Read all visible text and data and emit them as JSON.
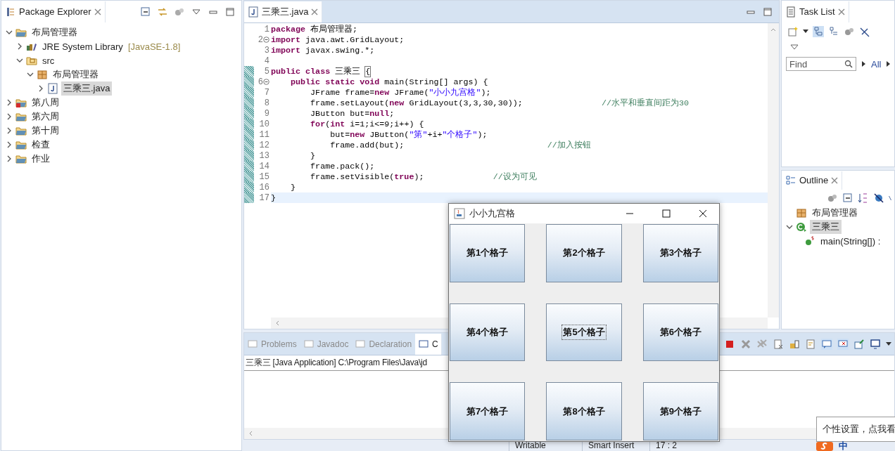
{
  "package_explorer": {
    "title": "Package Explorer",
    "tree": [
      {
        "label": "布局管理器",
        "kind": "project",
        "expanded": true,
        "selected": false,
        "children": [
          {
            "label": "JRE System Library",
            "decoration": "[JavaSE-1.8]",
            "kind": "library",
            "expanded": false,
            "selected": false
          },
          {
            "label": "src",
            "kind": "source",
            "expanded": true,
            "selected": false,
            "children": [
              {
                "label": "布局管理器",
                "kind": "package",
                "expanded": true,
                "selected": false,
                "children": [
                  {
                    "label": "三乘三.java",
                    "kind": "java",
                    "expanded": false,
                    "selected": true
                  }
                ]
              }
            ]
          }
        ]
      },
      {
        "label": "第八周",
        "kind": "project_error",
        "expanded": false,
        "selected": false
      },
      {
        "label": "第六周",
        "kind": "project",
        "expanded": false,
        "selected": false
      },
      {
        "label": "第十周",
        "kind": "project",
        "expanded": false,
        "selected": false
      },
      {
        "label": "检查",
        "kind": "project",
        "expanded": false,
        "selected": false
      },
      {
        "label": "作业",
        "kind": "project",
        "expanded": false,
        "selected": false
      }
    ]
  },
  "editor": {
    "tab": {
      "label": "三乘三.java",
      "selected": true
    },
    "lines": [
      {
        "n": "1",
        "changed": false,
        "foldable": false,
        "current": false,
        "tokens": [
          {
            "kind": "keyword",
            "text": "package"
          },
          {
            "kind": "plain",
            "text": " 布局管理器;"
          }
        ]
      },
      {
        "n": "2",
        "changed": false,
        "foldable": true,
        "current": false,
        "tokens": [
          {
            "kind": "keyword",
            "text": "import"
          },
          {
            "kind": "plain",
            "text": " java.awt.GridLayout;"
          }
        ]
      },
      {
        "n": "3",
        "changed": false,
        "foldable": false,
        "current": false,
        "tokens": [
          {
            "kind": "keyword",
            "text": "import"
          },
          {
            "kind": "plain",
            "text": " javax.swing.*;"
          }
        ]
      },
      {
        "n": "4",
        "changed": false,
        "foldable": false,
        "current": false
      },
      {
        "n": "5",
        "changed": true,
        "foldable": false,
        "current": false,
        "tokens": [
          {
            "kind": "keyword",
            "text": "public class"
          },
          {
            "kind": "plain",
            "text": " 三乘三 "
          },
          {
            "kind": "bracket",
            "text": "{"
          }
        ]
      },
      {
        "n": "6",
        "changed": true,
        "foldable": true,
        "current": false,
        "tokens": [
          {
            "kind": "keyword",
            "text": "    public static void"
          },
          {
            "kind": "plain",
            "text": " main(String[] args) {"
          }
        ]
      },
      {
        "n": "7",
        "changed": true,
        "foldable": false,
        "current": false,
        "tokens": [
          {
            "kind": "plain",
            "text": "        JFrame frame="
          },
          {
            "kind": "keyword",
            "text": "new"
          },
          {
            "kind": "plain",
            "text": " JFrame("
          },
          {
            "kind": "string",
            "text": "\"小小九宫格\""
          },
          {
            "kind": "plain",
            "text": ");"
          }
        ]
      },
      {
        "n": "8",
        "changed": true,
        "foldable": false,
        "current": false,
        "tokens": [
          {
            "kind": "plain",
            "text": "        frame.setLayout("
          },
          {
            "kind": "keyword",
            "text": "new"
          },
          {
            "kind": "plain",
            "text": " GridLayout(3,3,30,30));                "
          },
          {
            "kind": "comment",
            "text": "//水平和垂直间距为30"
          }
        ]
      },
      {
        "n": "9",
        "changed": true,
        "foldable": false,
        "current": false,
        "tokens": [
          {
            "kind": "plain",
            "text": "        JButton but="
          },
          {
            "kind": "keyword",
            "text": "null"
          },
          {
            "kind": "plain",
            "text": ";"
          }
        ]
      },
      {
        "n": "10",
        "changed": true,
        "foldable": false,
        "current": false,
        "tokens": [
          {
            "kind": "keyword",
            "text": "        for"
          },
          {
            "kind": "plain",
            "text": "("
          },
          {
            "kind": "keyword",
            "text": "int"
          },
          {
            "kind": "plain",
            "text": " i=1;i<=9;i++) {"
          }
        ]
      },
      {
        "n": "11",
        "changed": true,
        "foldable": false,
        "current": false,
        "tokens": [
          {
            "kind": "plain",
            "text": "            but="
          },
          {
            "kind": "keyword",
            "text": "new"
          },
          {
            "kind": "plain",
            "text": " JButton("
          },
          {
            "kind": "string",
            "text": "\"第\""
          },
          {
            "kind": "plain",
            "text": "+i+"
          },
          {
            "kind": "string",
            "text": "\"个格子\""
          },
          {
            "kind": "plain",
            "text": ");"
          }
        ]
      },
      {
        "n": "12",
        "changed": true,
        "foldable": false,
        "current": false,
        "tokens": [
          {
            "kind": "plain",
            "text": "            frame.add(but);                             "
          },
          {
            "kind": "comment",
            "text": "//加入按钮"
          }
        ]
      },
      {
        "n": "13",
        "changed": true,
        "foldable": false,
        "current": false,
        "tokens": [
          {
            "kind": "plain",
            "text": "        }"
          }
        ]
      },
      {
        "n": "14",
        "changed": true,
        "foldable": false,
        "current": false,
        "tokens": [
          {
            "kind": "plain",
            "text": "        frame.pack();"
          }
        ]
      },
      {
        "n": "15",
        "changed": true,
        "foldable": false,
        "current": false,
        "tokens": [
          {
            "kind": "plain",
            "text": "        frame.setVisible("
          },
          {
            "kind": "keyword",
            "text": "true"
          },
          {
            "kind": "plain",
            "text": ");              "
          },
          {
            "kind": "comment",
            "text": "//设为可见"
          }
        ]
      },
      {
        "n": "16",
        "changed": true,
        "foldable": false,
        "current": false,
        "tokens": [
          {
            "kind": "plain",
            "text": "    }"
          }
        ]
      },
      {
        "n": "17",
        "changed": true,
        "foldable": false,
        "current": true,
        "tokens": [
          {
            "kind": "plain",
            "text": "}"
          }
        ]
      }
    ]
  },
  "bottom_panel": {
    "tabs": [
      {
        "label": "Problems",
        "selected": false
      },
      {
        "label": "Javadoc",
        "selected": false
      },
      {
        "label": "Declaration",
        "selected": false
      },
      {
        "label": "C",
        "selected": true
      }
    ],
    "console_header": "三乘三 [Java Application] C:\\Program Files\\Java\\jd"
  },
  "task_list": {
    "title": "Task List",
    "find": {
      "placeholder": "Find"
    },
    "filter": "All"
  },
  "outline": {
    "title": "Outline",
    "tree": [
      {
        "label": "布局管理器",
        "kind": "package",
        "selected": false
      },
      {
        "label": "三乘三",
        "kind": "class",
        "expanded": true,
        "selected": true,
        "children": [
          {
            "label": "main(String[]) :",
            "kind": "method",
            "selected": false
          }
        ]
      }
    ]
  },
  "status_bar": {
    "items": [
      "Writable",
      "Smart Insert",
      "17 : 2"
    ],
    "ime": "中"
  },
  "tooltip": "个性设置，点我看",
  "swing_window": {
    "title": "小小九宫格",
    "buttons": [
      {
        "label": "第1个格子",
        "focused": false
      },
      {
        "label": "第2个格子",
        "focused": false
      },
      {
        "label": "第3个格子",
        "focused": false
      },
      {
        "label": "第4个格子",
        "focused": false
      },
      {
        "label": "第5个格子",
        "focused": true
      },
      {
        "label": "第6个格子",
        "focused": false
      },
      {
        "label": "第7个格子",
        "focused": false
      },
      {
        "label": "第8个格子",
        "focused": false
      },
      {
        "label": "第9个格子",
        "focused": false
      }
    ]
  }
}
